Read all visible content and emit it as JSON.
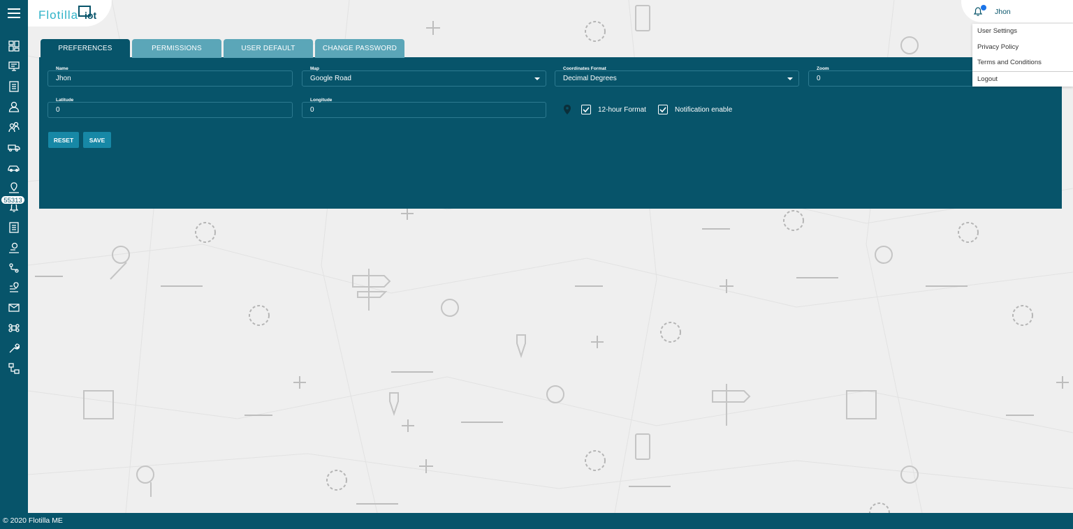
{
  "app": {
    "logo_text": "Flotilla IOT",
    "footer": "© 2020 Flotilla ME"
  },
  "header": {
    "user_name": "Jhon",
    "notification_count": "55313"
  },
  "user_menu": {
    "items": [
      "User Settings",
      "Privacy Policy",
      "Terms and Conditions",
      "Logout"
    ]
  },
  "tabs": [
    "PREFERENCES",
    "PERMISSIONS",
    "USER DEFAULT",
    "CHANGE PASSWORD"
  ],
  "form": {
    "name": {
      "label": "Name",
      "value": "Jhon"
    },
    "map": {
      "label": "Map",
      "value": "Google Road"
    },
    "coordinates_format": {
      "label": "Coordinates Format",
      "value": "Decimal Degrees"
    },
    "zoom": {
      "label": "Zoom",
      "value": "0"
    },
    "latitude": {
      "label": "Latitude",
      "value": "0"
    },
    "longitude": {
      "label": "Longitude",
      "value": "0"
    },
    "hour_format": {
      "label": "12-hour Format",
      "checked": true
    },
    "notification": {
      "label": "Notification enable",
      "checked": true
    }
  },
  "buttons": {
    "reset": "RESET",
    "save": "SAVE"
  },
  "sidebar_icons": [
    "dashboard-icon",
    "monitor-icon",
    "checklist-icon",
    "user-icon",
    "users-icon",
    "truck-icon",
    "car-icon",
    "location-user-icon",
    "bell-icon",
    "report-icon",
    "driver-icon",
    "route-icon",
    "geofence-icon",
    "mail-icon",
    "command-icon",
    "wrench-icon",
    "workflow-icon"
  ],
  "colors": {
    "primary": "#07546a",
    "tab_inactive": "#5ba6b8",
    "button": "#1788a6"
  }
}
